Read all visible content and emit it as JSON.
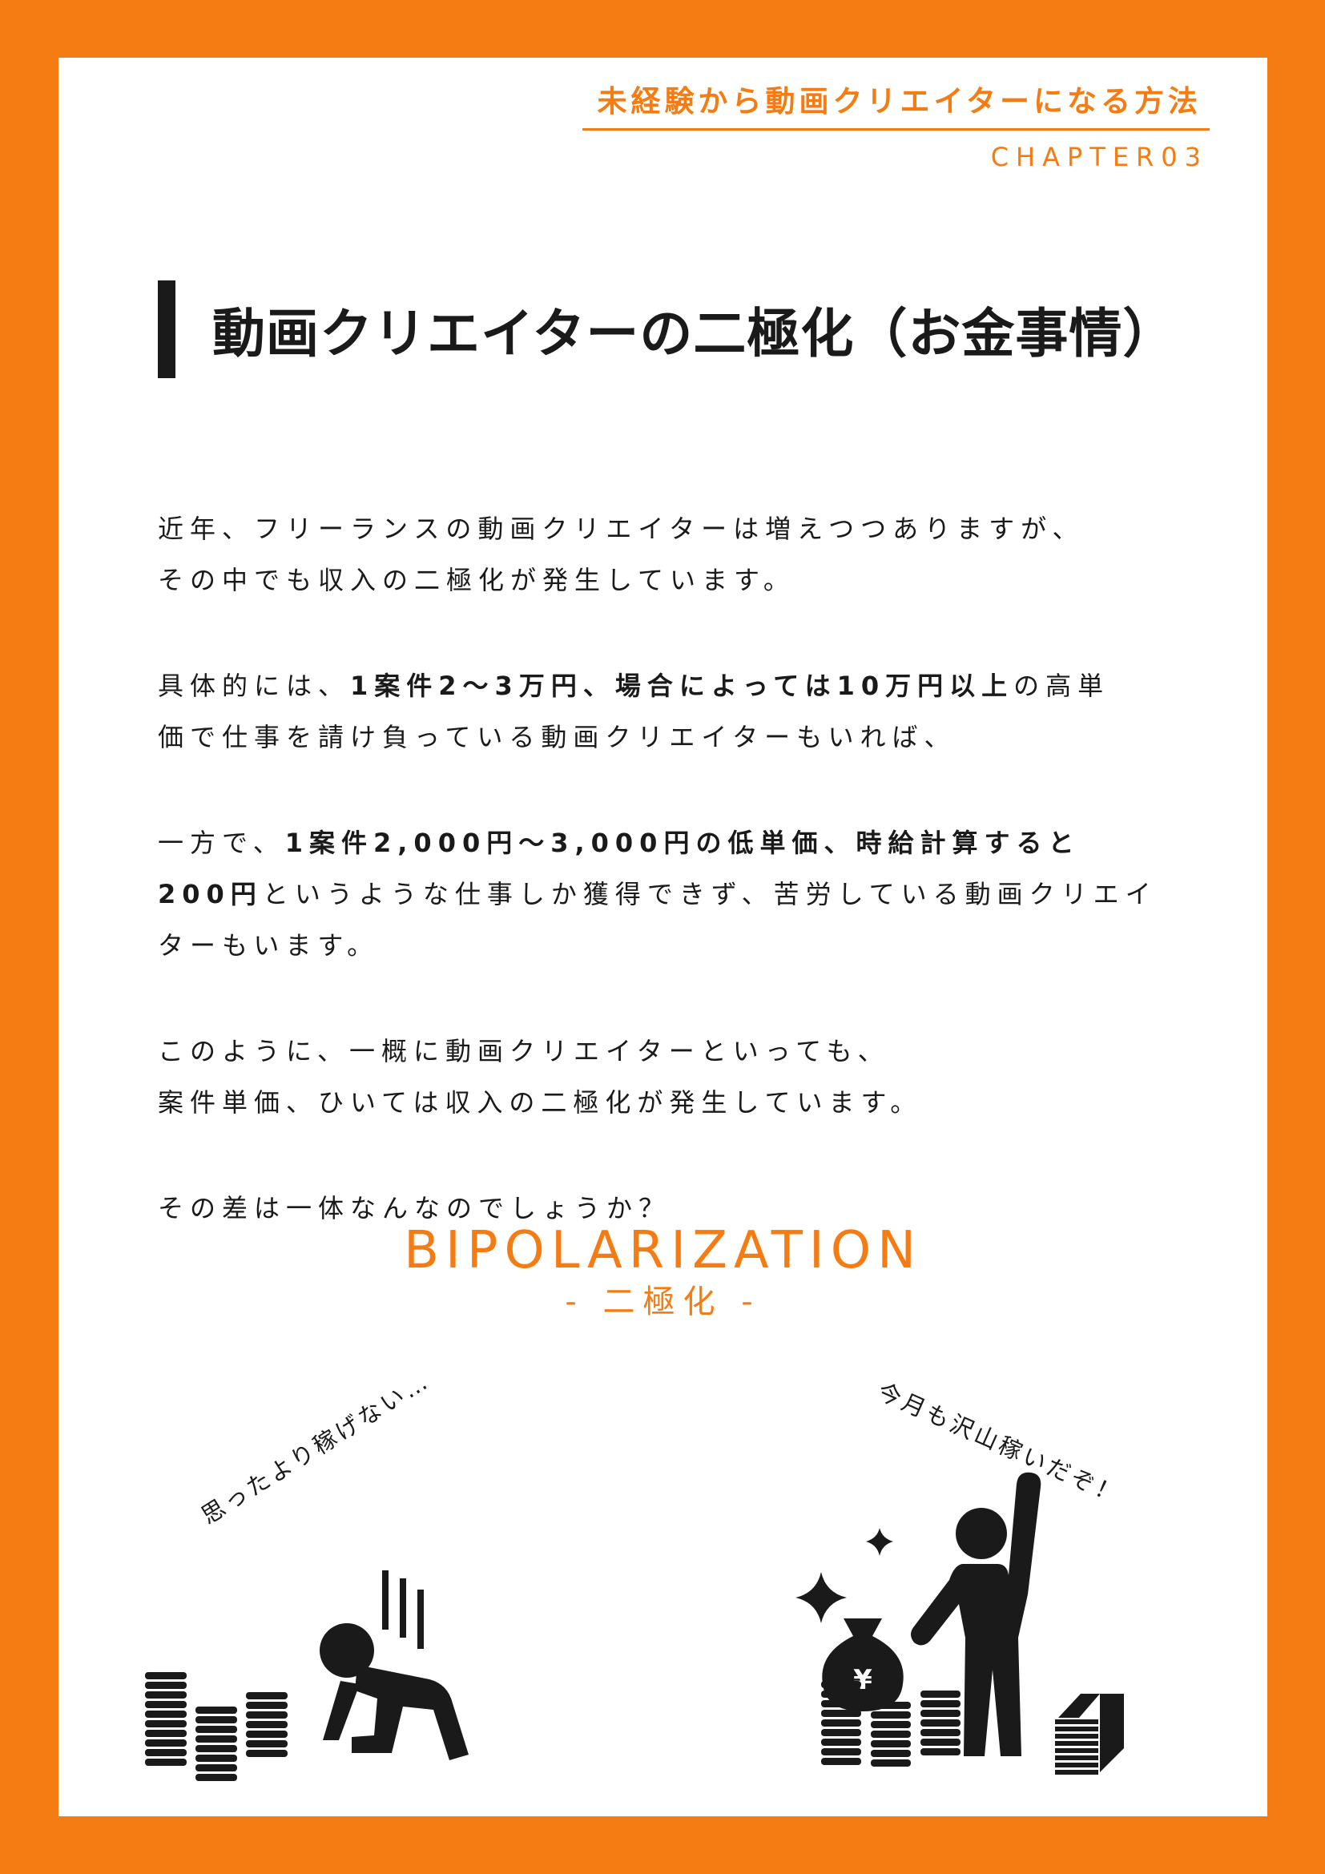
{
  "header": {
    "title": "未経験から動画クリエイターになる方法",
    "chapter": "CHAPTER03"
  },
  "section": {
    "heading": "動画クリエイターの二極化（お金事情）"
  },
  "paragraphs": {
    "p1_line1": "近年、フリーランスの動画クリエイターは増えつつありますが、",
    "p1_line2": "その中でも収入の二極化が発生しています。",
    "p2_line1_a": "具体的には、",
    "p2_line1_b": "1案件2〜3万円、場合によっては10万円以上",
    "p2_line1_c": "の高単",
    "p2_line2": "価で仕事を請け負っている動画クリエイターもいれば、",
    "p3_line1_a": "一方で、",
    "p3_line1_b": "1案件2,000円〜3,000円の低単価、時給計算すると",
    "p3_line2_a": "200円",
    "p3_line2_b": "というような仕事しか獲得できず、苦労している動画クリエイ",
    "p3_line3": "ターもいます。",
    "p4_line1": "このように、一概に動画クリエイターといっても、",
    "p4_line2": "案件単価、ひいては収入の二極化が発生しています。",
    "p5_line1": "その差は一体なんなのでしょうか？"
  },
  "bipolarization": {
    "title": "BIPOLARIZATION",
    "subtitle": "- 二極化 -"
  },
  "captions": {
    "left": "思ったより稼げない…",
    "right": "今月も沢山稼いだぞ！"
  },
  "icons": {
    "left": [
      "coins-stack-icon",
      "discouraged-person-icon",
      "gloom-lines-icon"
    ],
    "right": [
      "sparkle-icon",
      "money-bag-icon",
      "coins-stack-icon",
      "triumphant-person-icon",
      "cash-stack-icon"
    ],
    "money_bag_symbol": "¥"
  },
  "colors": {
    "accent": "#F57B13",
    "text": "#1a1a1a",
    "page": "#ffffff"
  }
}
